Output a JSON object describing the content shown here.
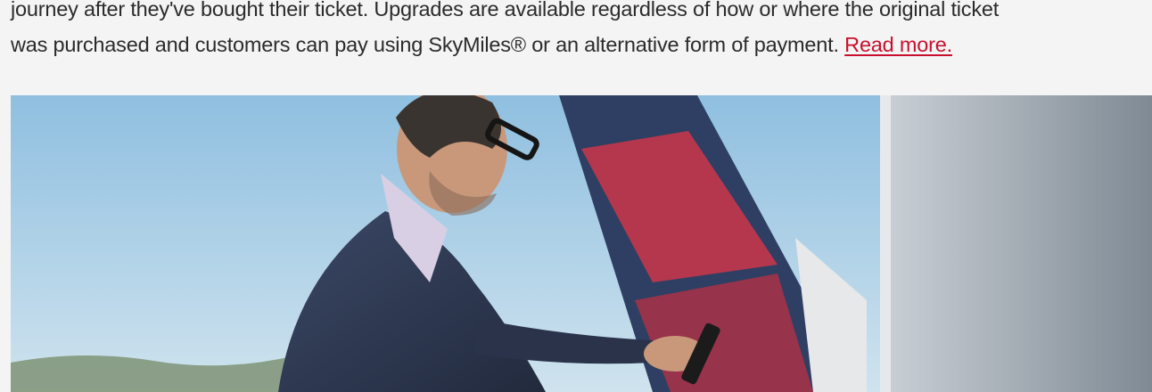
{
  "article": {
    "text_line_1": "journey after they've bought their ticket. Upgrades are available regardless of how or where the original ticket",
    "text_line_2": "was purchased and customers can pay using SkyMiles® or an alternative form of payment.",
    "read_more_label": "Read more."
  },
  "hero_image": {
    "alt": "",
    "colors": {
      "sky": "#a9cfe8",
      "tail_blue": "#2e3f63",
      "tail_red": "#c0364b",
      "suit": "#2f3a52",
      "shirt": "#d9cfe4",
      "skin": "#c9987a",
      "hair": "#3a3430",
      "window_frame": "#d8dcdf"
    }
  }
}
